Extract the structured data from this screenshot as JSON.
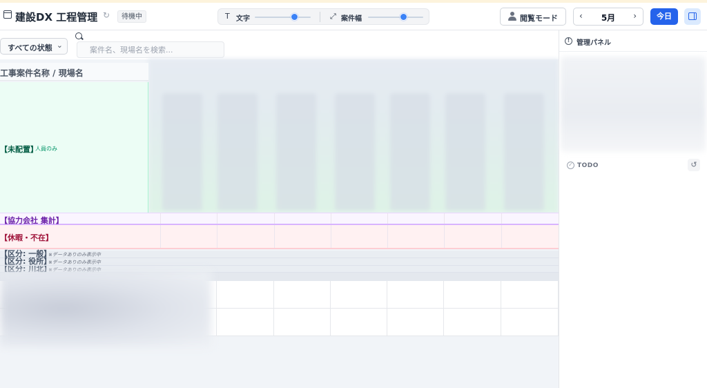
{
  "header": {
    "title": "建設DX 工程管理",
    "status_badge": "待機中",
    "text_size": {
      "icon": "T",
      "label": "文字",
      "level": 0.72
    },
    "column_width": {
      "icon": "⤢",
      "label": "案件幅",
      "level": 0.65
    },
    "view_mode_label": "閲覧モード",
    "month": "5月",
    "prev": "‹",
    "next": "›",
    "today_label": "今日"
  },
  "toolbar": {
    "state_filter": "すべての状態",
    "search_placeholder": "案件名、現場名を検索..."
  },
  "grid": {
    "column_header": "工事案件名称 / 現場名",
    "unassigned_label": "【未配置】",
    "unassigned_note": "人員のみ",
    "partner_label": "【協力会社 集計】",
    "leave_label": "【休暇・不在】",
    "categories": [
      {
        "label": "【区分: 一般】",
        "note": "※データありのみ表示中"
      },
      {
        "label": "【区分: 役所】",
        "note": "※データありのみ表示中"
      },
      {
        "label": "【区分: 川北】",
        "note": "※データありのみ表示中"
      }
    ]
  },
  "side_panel": {
    "title": "管理パネル",
    "info_icon": "!",
    "todo_label": "TODO",
    "todo_icon": "✓",
    "history_icon": "↺"
  },
  "colors": {
    "accent": "#2563eb",
    "unassigned_bg": "#ecfdf5",
    "partner_bg": "#faf5ff",
    "leave_bg": "#fff1f2"
  }
}
